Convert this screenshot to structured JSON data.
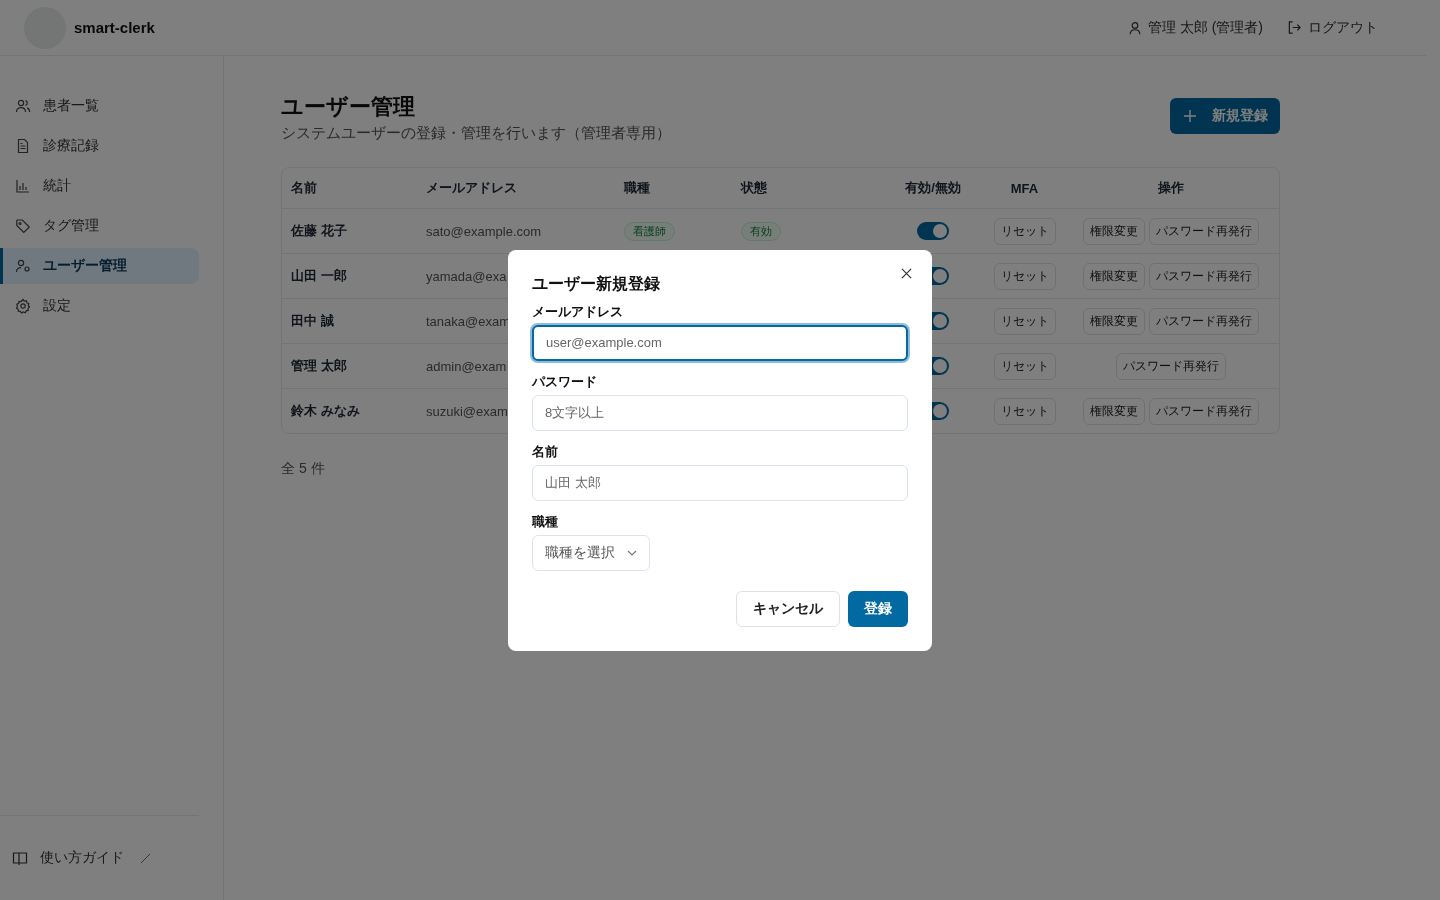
{
  "header": {
    "app_name": "smart-clerk",
    "user": "管理 太郎 (管理者)",
    "logout": "ログアウト"
  },
  "sidebar": {
    "items": [
      {
        "label": "患者一覧",
        "selected": false
      },
      {
        "label": "診療記録",
        "selected": false
      },
      {
        "label": "統計",
        "selected": false
      },
      {
        "label": "タグ管理",
        "selected": false
      },
      {
        "label": "ユーザー管理",
        "selected": true
      },
      {
        "label": "設定",
        "selected": false
      }
    ],
    "guide": "使い方ガイド"
  },
  "page": {
    "title": "ユーザー管理",
    "subtitle": "システムユーザーの登録・管理を行います（管理者専用）",
    "new_button": "新規登録"
  },
  "table": {
    "columns": [
      "名前",
      "メールアドレス",
      "職種",
      "状態",
      "有効/無効",
      "MFA",
      "操作"
    ],
    "rows": [
      {
        "name": "佐藤 花子",
        "email": "sato@example.com",
        "role": "看護師",
        "status": "有効",
        "enabled": true,
        "mfa": "リセット",
        "actions": [
          "権限変更",
          "パスワード再発行"
        ]
      },
      {
        "name": "山田 一郎",
        "email": "yamada@exa",
        "enabled": true,
        "mfa": "リセット",
        "actions": [
          "権限変更",
          "パスワード再発行"
        ]
      },
      {
        "name": "田中 誠",
        "email": "tanaka@exam",
        "enabled": true,
        "mfa": "リセット",
        "actions": [
          "権限変更",
          "パスワード再発行"
        ]
      },
      {
        "name": "管理 太郎",
        "email": "admin@exam",
        "enabled": true,
        "mfa": "リセット",
        "actions": [
          "パスワード再発行"
        ]
      },
      {
        "name": "鈴木 みなみ",
        "email": "suzuki@exam",
        "enabled": true,
        "mfa": "リセット",
        "actions": [
          "権限変更",
          "パスワード再発行"
        ]
      }
    ]
  },
  "total": "全 5 件",
  "dialog": {
    "title": "ユーザー新規登録",
    "fields": [
      {
        "label": "メールアドレス",
        "kind": "text",
        "placeholder": "user@example.com",
        "focused": true
      },
      {
        "label": "パスワード",
        "kind": "text",
        "placeholder": "8文字以上",
        "focused": false
      },
      {
        "label": "名前",
        "kind": "text",
        "placeholder": "山田 太郎",
        "focused": false
      },
      {
        "label": "職種",
        "kind": "select",
        "placeholder": "職種を選択",
        "focused": false
      }
    ],
    "cancel": "キャンセル",
    "submit": "登録"
  }
}
